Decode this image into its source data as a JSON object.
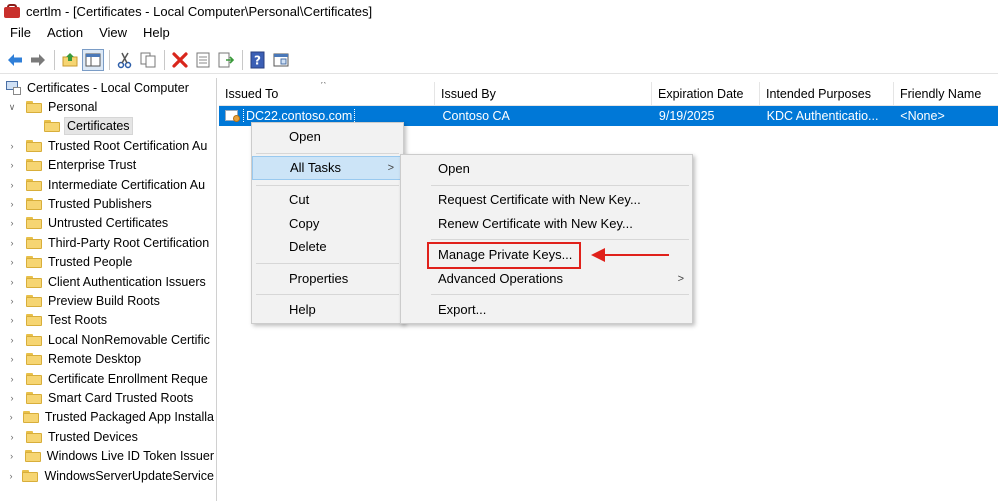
{
  "window": {
    "title": "certlm - [Certificates - Local Computer\\Personal\\Certificates]"
  },
  "menu": [
    "File",
    "Action",
    "View",
    "Help"
  ],
  "toolbar": {
    "icons": [
      "back-arrow-icon",
      "forward-arrow-icon",
      "up-folder-icon",
      "show-hide-tree-icon",
      "cut-icon",
      "copy-icon",
      "delete-icon",
      "properties-icon",
      "export-list-icon",
      "help-icon",
      "mmc-view-icon"
    ]
  },
  "tree": {
    "root": "Certificates - Local Computer",
    "personal": "Personal",
    "certificates": "Certificates",
    "items": [
      "Trusted Root Certification Au",
      "Enterprise Trust",
      "Intermediate Certification Au",
      "Trusted Publishers",
      "Untrusted Certificates",
      "Third-Party Root Certification",
      "Trusted People",
      "Client Authentication Issuers",
      "Preview Build Roots",
      "Test Roots",
      "Local NonRemovable Certific",
      "Remote Desktop",
      "Certificate Enrollment Reque",
      "Smart Card Trusted Roots",
      "Trusted Packaged App Installa",
      "Trusted Devices",
      "Windows Live ID Token Issuer",
      "WindowsServerUpdateService"
    ]
  },
  "table": {
    "columns": [
      "Issued To",
      "Issued By",
      "Expiration Date",
      "Intended Purposes",
      "Friendly Name"
    ],
    "sort_indicator": "^",
    "rows": [
      {
        "issued_to": "DC22.contoso.com",
        "issued_by": "Contoso CA",
        "expiration": "9/19/2025",
        "purposes": "KDC Authenticatio...",
        "friendly": "<None>"
      }
    ]
  },
  "context_menu": {
    "open": "Open",
    "all_tasks": "All Tasks",
    "all_tasks_arrow": ">",
    "cut": "Cut",
    "copy": "Copy",
    "delete": "Delete",
    "properties": "Properties",
    "help": "Help"
  },
  "submenu": {
    "open": "Open",
    "request_new_key": "Request Certificate with New Key...",
    "renew_new_key": "Renew Certificate with New Key...",
    "manage_private_keys": "Manage Private Keys...",
    "advanced_operations": "Advanced Operations",
    "advanced_arrow": ">",
    "export": "Export..."
  },
  "colors": {
    "selection": "#0078d7",
    "menu_highlight": "#cce4f7",
    "annotation": "#e0211b"
  }
}
